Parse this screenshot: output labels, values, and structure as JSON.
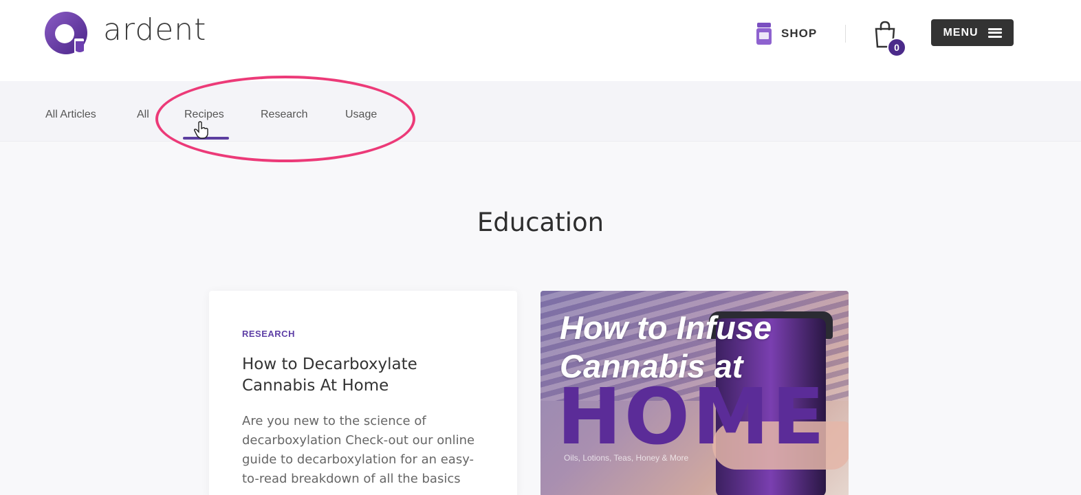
{
  "brand": {
    "name": "ardent",
    "accent": "#5c3ea0",
    "highlight": "#ec3a78"
  },
  "header": {
    "shop_label": "SHOP",
    "cart_count": "0",
    "menu_label": "MENU"
  },
  "subnav": {
    "items": [
      {
        "label": "All Articles"
      },
      {
        "label": "All"
      },
      {
        "label": "Recipes",
        "active": true
      },
      {
        "label": "Research"
      },
      {
        "label": "Usage"
      }
    ]
  },
  "page": {
    "title": "Education"
  },
  "cards": [
    {
      "category": "RESEARCH",
      "title": "How to Decarboxylate Cannabis At Home",
      "excerpt": "Are you new to the science of decarboxylation Check-out our online guide to decarboxylation for an easy-to-read breakdown of all the basics"
    }
  ],
  "hero": {
    "line1": "How to Infuse",
    "line2": "Cannabis at",
    "line3": "HOME",
    "caption": "Oils, Lotions, Teas, Honey & More"
  },
  "icons": {
    "logo": "ardent-logo-icon",
    "shop": "jar-icon",
    "cart": "shopping-bag-icon",
    "menu": "hamburger-icon",
    "cursor": "hand-cursor-icon"
  }
}
